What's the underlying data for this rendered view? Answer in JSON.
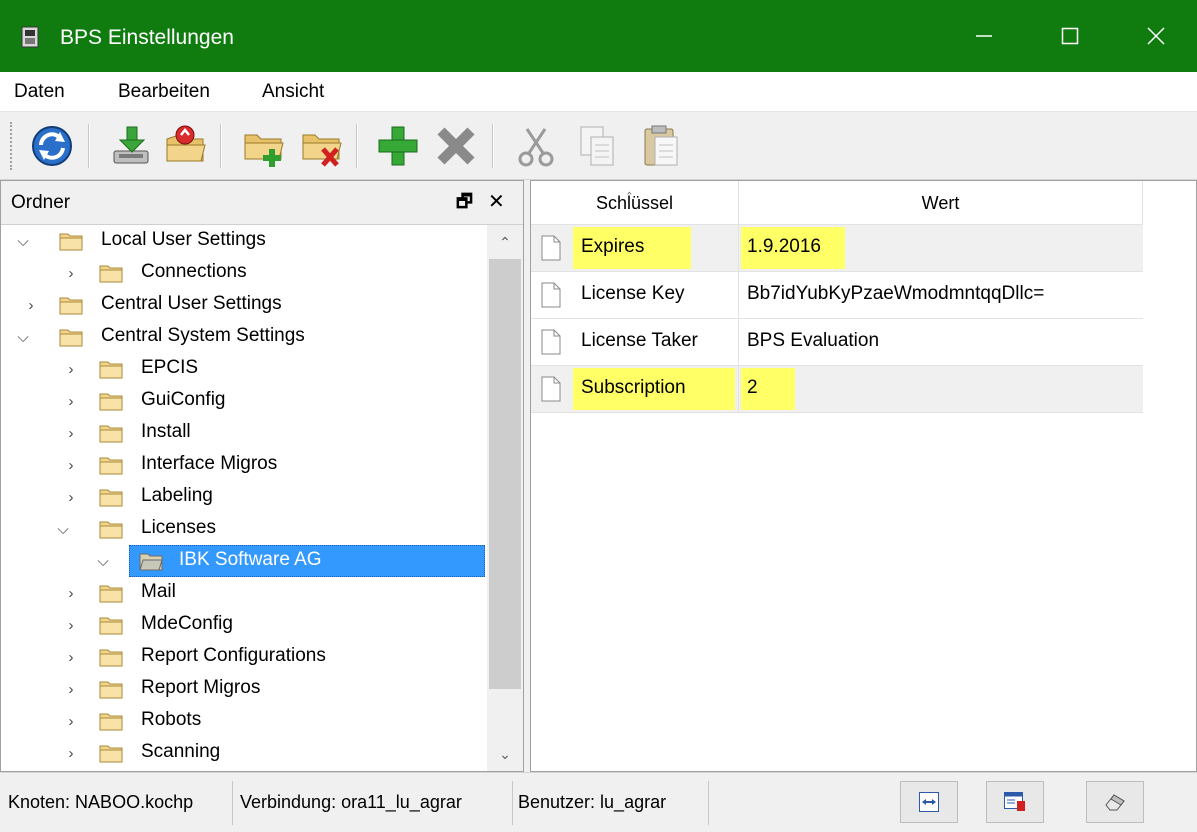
{
  "window": {
    "title": "BPS Einstellungen",
    "accent": "#107c10"
  },
  "menu": {
    "items": [
      "Daten",
      "Bearbeiten",
      "Ansicht"
    ]
  },
  "toolbar": {
    "icons": [
      "refresh-icon",
      "import-icon",
      "export-icon",
      "new-folder-icon",
      "delete-folder-icon",
      "add-icon",
      "remove-icon",
      "cut-icon",
      "copy-icon",
      "paste-icon"
    ]
  },
  "left_pane": {
    "title": "Ordner",
    "tree": [
      {
        "label": "Local User Settings",
        "expanded": true
      },
      {
        "label": "Connections",
        "expanded": false
      },
      {
        "label": "Central User Settings",
        "expanded": false
      },
      {
        "label": "Central System Settings",
        "expanded": true
      },
      {
        "label": "EPCIS",
        "expanded": false
      },
      {
        "label": "GuiConfig",
        "expanded": false
      },
      {
        "label": "Install",
        "expanded": false
      },
      {
        "label": "Interface Migros",
        "expanded": false
      },
      {
        "label": "Labeling",
        "expanded": false
      },
      {
        "label": "Licenses",
        "expanded": true
      },
      {
        "label": "IBK Software AG",
        "expanded": true,
        "selected": true
      },
      {
        "label": "Mail",
        "expanded": false
      },
      {
        "label": "MdeConfig",
        "expanded": false
      },
      {
        "label": "Report Configurations",
        "expanded": false
      },
      {
        "label": "Report Migros",
        "expanded": false
      },
      {
        "label": "Robots",
        "expanded": false
      },
      {
        "label": "Scanning",
        "expanded": false
      }
    ]
  },
  "grid": {
    "col_key": "Schlüssel",
    "col_value": "Wert",
    "rows": [
      {
        "key": "Expires",
        "value": "1.9.2016",
        "highlighted": true
      },
      {
        "key": "License Key",
        "value": "Bb7idYubKyPzaeWmodmntqqDllc=",
        "highlighted": false
      },
      {
        "key": "License Taker",
        "value": "BPS Evaluation",
        "highlighted": false
      },
      {
        "key": "Subscription",
        "value": "2",
        "highlighted": true
      }
    ]
  },
  "status": {
    "node": "Knoten: NABOO.kochp",
    "connection": "Verbindung: ora11_lu_agrar",
    "user": "Benutzer: lu_agrar"
  },
  "colors": {
    "highlight": "#ffff66",
    "selection": "#3399ff"
  }
}
